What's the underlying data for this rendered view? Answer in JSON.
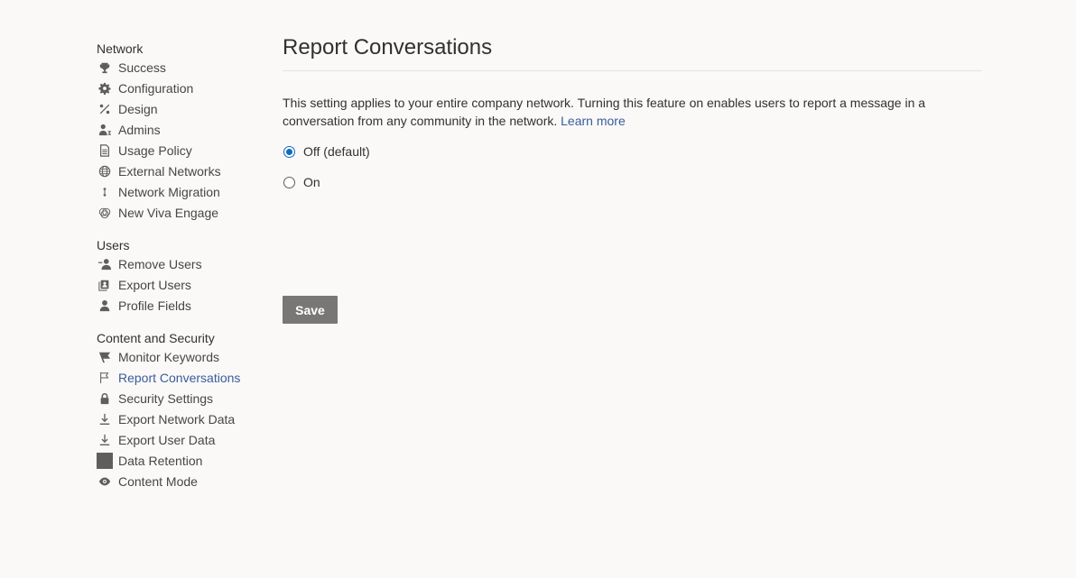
{
  "sidebar": {
    "sections": [
      {
        "title": "Network",
        "items": [
          {
            "label": "Success",
            "icon": "trophy-icon"
          },
          {
            "label": "Configuration",
            "icon": "gear-icon"
          },
          {
            "label": "Design",
            "icon": "design-icon"
          },
          {
            "label": "Admins",
            "icon": "admin-icon"
          },
          {
            "label": "Usage Policy",
            "icon": "document-icon"
          },
          {
            "label": "External Networks",
            "icon": "globe-icon"
          },
          {
            "label": "Network Migration",
            "icon": "arrows-vertical-icon"
          },
          {
            "label": "New Viva Engage",
            "icon": "viva-engage-icon"
          }
        ]
      },
      {
        "title": "Users",
        "items": [
          {
            "label": "Remove Users",
            "icon": "remove-user-icon"
          },
          {
            "label": "Export Users",
            "icon": "export-users-icon"
          },
          {
            "label": "Profile Fields",
            "icon": "person-icon"
          }
        ]
      },
      {
        "title": "Content and Security",
        "items": [
          {
            "label": "Monitor Keywords",
            "icon": "flag-filled-icon"
          },
          {
            "label": "Report Conversations",
            "icon": "flag-outline-icon",
            "active": true
          },
          {
            "label": "Security Settings",
            "icon": "lock-icon"
          },
          {
            "label": "Export Network Data",
            "icon": "download-icon"
          },
          {
            "label": "Export User Data",
            "icon": "download-icon"
          },
          {
            "label": "Data Retention",
            "icon": "square-icon"
          },
          {
            "label": "Content Mode",
            "icon": "eye-icon"
          }
        ]
      }
    ]
  },
  "main": {
    "title": "Report Conversations",
    "description": "This setting applies to your entire company network. Turning this feature on enables users to report a message in a conversation from any community in the network.",
    "learn_more": "Learn more",
    "options": [
      {
        "label": "Off (default)",
        "checked": true
      },
      {
        "label": "On",
        "checked": false
      }
    ],
    "save_label": "Save"
  },
  "colors": {
    "accent": "#3a5c9c",
    "radio_selected": "#0f6cbd",
    "save_button": "#797775",
    "icon": "#605e5c"
  }
}
